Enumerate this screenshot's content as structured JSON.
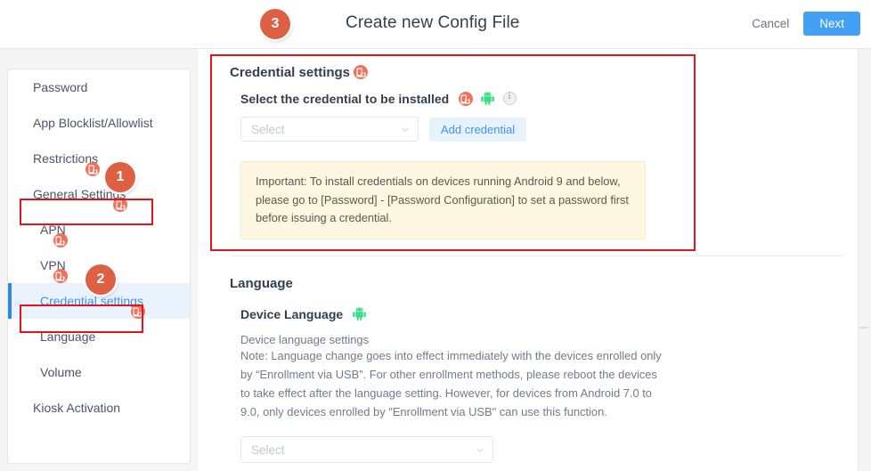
{
  "header": {
    "title": "Create new Config File",
    "cancel_label": "Cancel",
    "next_label": "Next"
  },
  "annotations": {
    "badge_1": "1",
    "badge_2": "2",
    "badge_3": "3",
    "highlight_color": "#e5141b",
    "badge_color": "#dd6044"
  },
  "sidebar": {
    "items": [
      {
        "label": "Password",
        "sub": false,
        "active": false,
        "lock": false
      },
      {
        "label": "App Blocklist/Allowlist",
        "sub": false,
        "active": false,
        "lock": false
      },
      {
        "label": "Restrictions",
        "sub": false,
        "active": false,
        "lock": true
      },
      {
        "label": "General Settings",
        "sub": false,
        "active": false,
        "lock": true
      },
      {
        "label": "APN",
        "sub": true,
        "active": false,
        "lock": true
      },
      {
        "label": "VPN",
        "sub": true,
        "active": false,
        "lock": true
      },
      {
        "label": "Credential settings",
        "sub": true,
        "active": true,
        "lock": true
      },
      {
        "label": "Language",
        "sub": true,
        "active": false,
        "lock": false
      },
      {
        "label": "Volume",
        "sub": true,
        "active": false,
        "lock": false
      },
      {
        "label": "Kiosk Activation",
        "sub": false,
        "active": false,
        "lock": false
      }
    ]
  },
  "credential_section": {
    "title": "Credential settings",
    "field_label": "Select the credential to be installed",
    "select_placeholder": "Select",
    "add_button_label": "Add credential",
    "notice": "Important: To install credentials on devices running Android 9 and below, please go to [Password] - [Password Configuration] to set a password first before issuing a credential."
  },
  "language_section": {
    "title": "Language",
    "field_label": "Device Language",
    "description": "Device language settings",
    "note": "Note: Language change goes into effect immediately with the devices enrolled only by “Enrollment via USB”. For other enrollment methods, please reboot the devices to take effect after the language setting. However, for devices from Android 7.0 to 9.0, only devices enrolled by \"Enrollment via USB\" can use this function.",
    "select_placeholder": "Select"
  },
  "icons": {
    "lock": "device-lock-icon",
    "android": "android-icon",
    "info": "info-icon",
    "chevron": "chevron-down-icon"
  }
}
